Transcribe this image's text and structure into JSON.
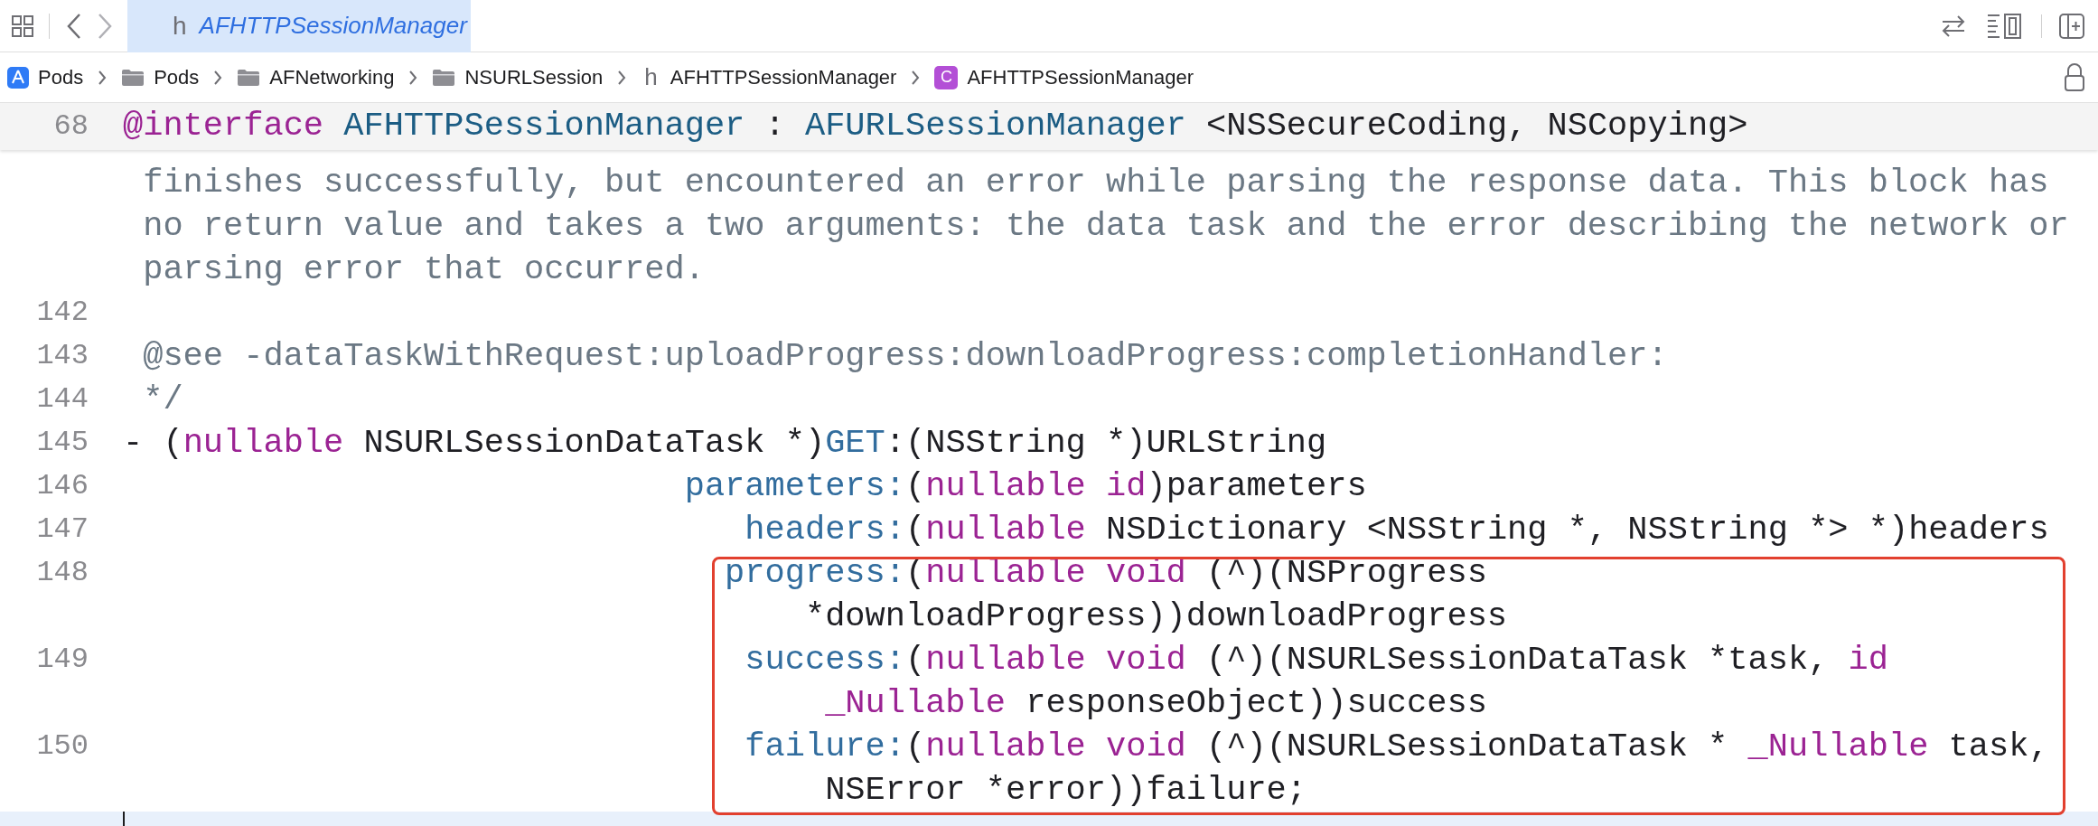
{
  "tab": {
    "glyph": "h",
    "title": "AFHTTPSessionManager",
    "selected": true
  },
  "breadcrumb": [
    {
      "kind": "app",
      "label": "Pods"
    },
    {
      "kind": "folder",
      "label": "Pods"
    },
    {
      "kind": "folder",
      "label": "AFNetworking"
    },
    {
      "kind": "folder",
      "label": "NSURLSession"
    },
    {
      "kind": "header",
      "glyph": "h",
      "label": "AFHTTPSessionManager"
    },
    {
      "kind": "class",
      "glyph": "C",
      "label": "AFHTTPSessionManager"
    }
  ],
  "sticky_line": {
    "number": "68",
    "segments": [
      {
        "kind": "keyword",
        "text": "@interface"
      },
      {
        "kind": "type",
        "text": " AFHTTPSessionManager"
      },
      {
        "kind": "plain",
        "text": " : "
      },
      {
        "kind": "type",
        "text": "AFURLSessionManager"
      },
      {
        "kind": "plain",
        "text": " <NSSecureCoding, NSCopying>"
      }
    ]
  },
  "lines": [
    {
      "segments": [
        {
          "kind": "comment",
          "text": " finishes successfully, but encountered an error while parsing the response data. This block has"
        }
      ]
    },
    {
      "segments": [
        {
          "kind": "comment",
          "text": " no return value and takes a two arguments: the data task and the error describing the network or"
        }
      ]
    },
    {
      "segments": [
        {
          "kind": "comment",
          "text": " parsing error that occurred."
        }
      ]
    },
    {
      "number": "142"
    },
    {
      "number": "143",
      "segments": [
        {
          "kind": "comment",
          "text": " @see -dataTaskWithRequest:uploadProgress:downloadProgress:completionHandler:"
        }
      ]
    },
    {
      "number": "144",
      "segments": [
        {
          "kind": "comment",
          "text": " */"
        }
      ]
    },
    {
      "number": "145",
      "segments": [
        {
          "kind": "plain",
          "text": "- ("
        },
        {
          "kind": "keyword",
          "text": "nullable"
        },
        {
          "kind": "plain",
          "text": " NSURLSessionDataTask *)"
        },
        {
          "kind": "selector",
          "text": "GET"
        },
        {
          "kind": "plain",
          "text": ":(NSString *)URLString"
        }
      ]
    },
    {
      "number": "146",
      "segments": [
        {
          "kind": "selector",
          "text": "                            parameters:"
        },
        {
          "kind": "plain",
          "text": "("
        },
        {
          "kind": "keyword",
          "text": "nullable id"
        },
        {
          "kind": "plain",
          "text": ")parameters"
        }
      ]
    },
    {
      "number": "147",
      "segments": [
        {
          "kind": "selector",
          "text": "                               headers:"
        },
        {
          "kind": "plain",
          "text": "("
        },
        {
          "kind": "keyword",
          "text": "nullable"
        },
        {
          "kind": "plain",
          "text": " NSDictionary <NSString *, NSString *> *)headers"
        }
      ]
    },
    {
      "number": "148",
      "segments": [
        {
          "kind": "selector",
          "text": "                              progress:"
        },
        {
          "kind": "plain",
          "text": "("
        },
        {
          "kind": "keyword",
          "text": "nullable void"
        },
        {
          "kind": "plain",
          "text": " (^)(NSProgress"
        }
      ]
    },
    {
      "segments": [
        {
          "kind": "plain",
          "text": "                                  *downloadProgress))downloadProgress"
        }
      ]
    },
    {
      "number": "149",
      "segments": [
        {
          "kind": "selector",
          "text": "                               success:"
        },
        {
          "kind": "plain",
          "text": "("
        },
        {
          "kind": "keyword",
          "text": "nullable void"
        },
        {
          "kind": "plain",
          "text": " (^)(NSURLSessionDataTask *task, "
        },
        {
          "kind": "keyword",
          "text": "id"
        }
      ]
    },
    {
      "segments": [
        {
          "kind": "keyword",
          "text": "                                   _Nullable"
        },
        {
          "kind": "plain",
          "text": " responseObject))success"
        }
      ]
    },
    {
      "number": "150",
      "segments": [
        {
          "kind": "selector",
          "text": "                               failure:"
        },
        {
          "kind": "plain",
          "text": "("
        },
        {
          "kind": "keyword",
          "text": "nullable void"
        },
        {
          "kind": "plain",
          "text": " (^)(NSURLSessionDataTask * "
        },
        {
          "kind": "keyword",
          "text": "_Nullable"
        },
        {
          "kind": "plain",
          "text": " task,"
        }
      ]
    },
    {
      "segments": [
        {
          "kind": "plain",
          "text": "                                   NSError *error))failure;"
        }
      ]
    }
  ]
}
